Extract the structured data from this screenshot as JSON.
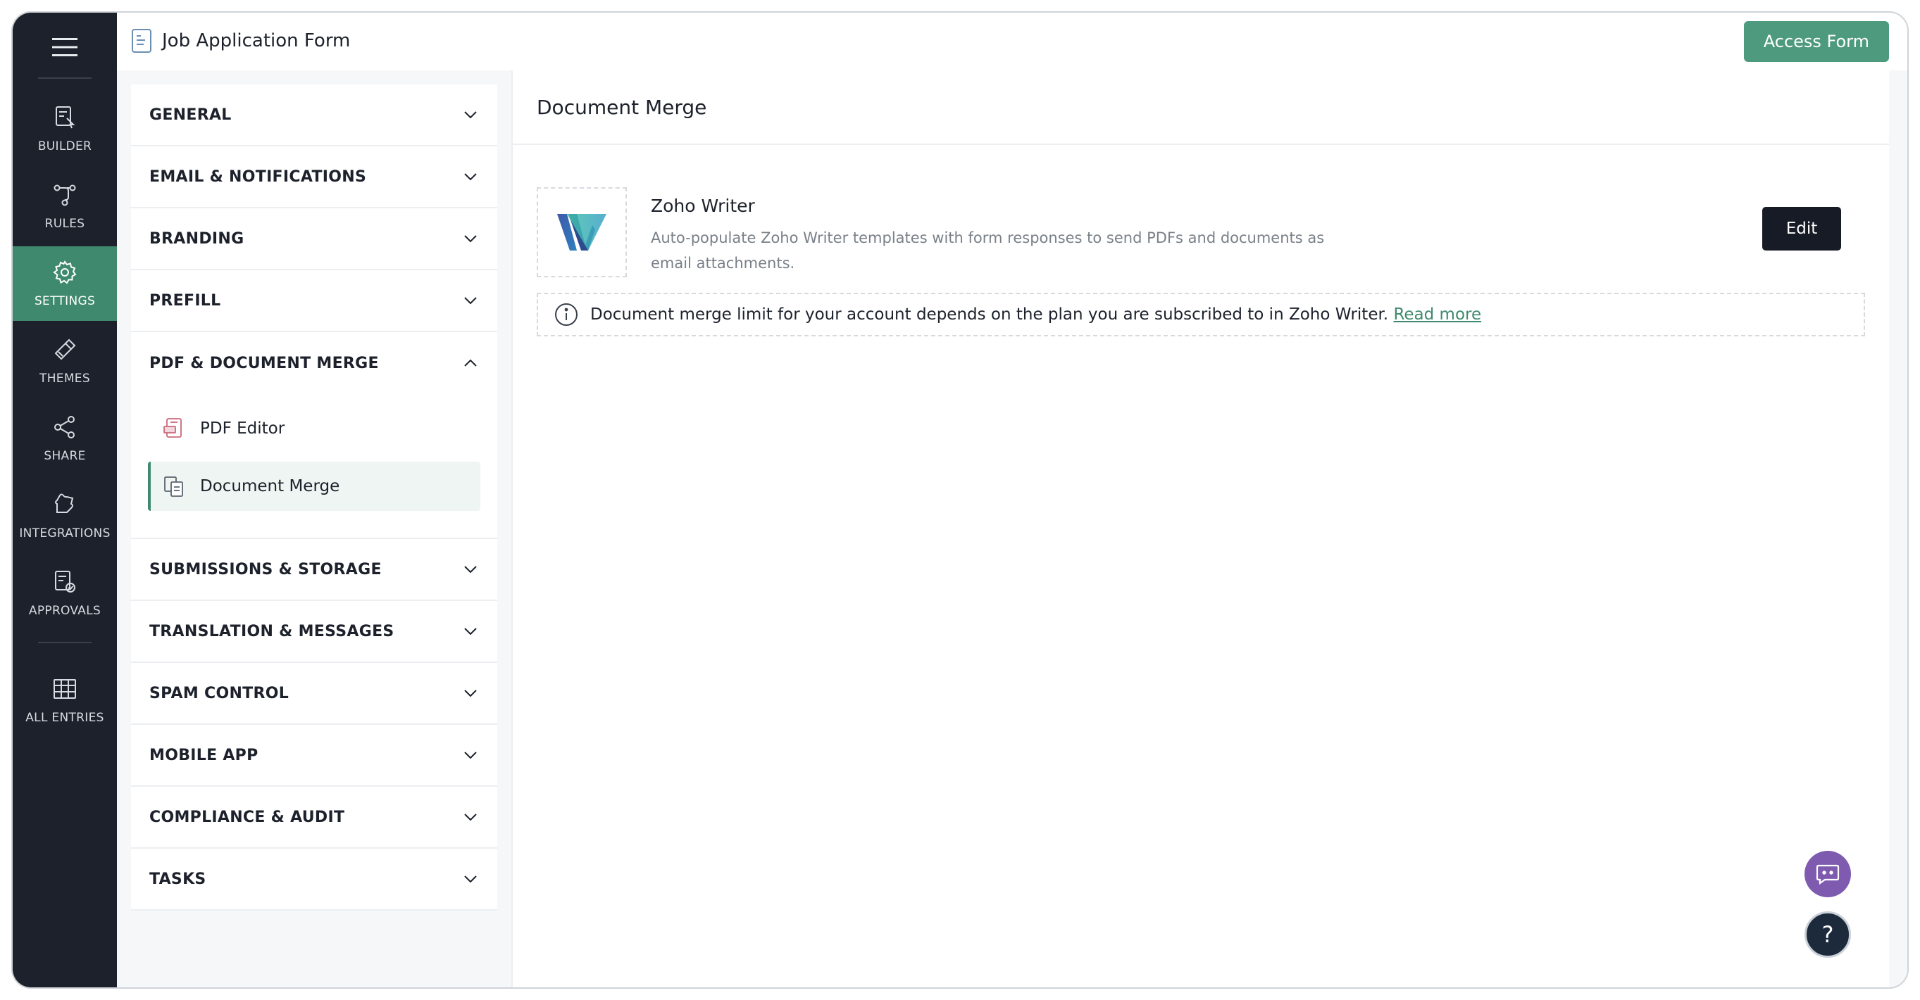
{
  "app": {
    "form_title": "Job Application Form",
    "access_button": "Access Form"
  },
  "rail": {
    "items": [
      {
        "label": "BUILDER",
        "icon": "builder-icon"
      },
      {
        "label": "RULES",
        "icon": "rules-icon"
      },
      {
        "label": "SETTINGS",
        "icon": "gear-icon"
      },
      {
        "label": "THEMES",
        "icon": "paint-icon"
      },
      {
        "label": "SHARE",
        "icon": "share-icon"
      },
      {
        "label": "INTEGRATIONS",
        "icon": "puzzle-icon"
      },
      {
        "label": "APPROVALS",
        "icon": "approvals-icon"
      },
      {
        "label": "ALL ENTRIES",
        "icon": "table-icon"
      }
    ],
    "active": "SETTINGS"
  },
  "menu": {
    "items": [
      {
        "label": "GENERAL"
      },
      {
        "label": "EMAIL & NOTIFICATIONS"
      },
      {
        "label": "BRANDING"
      },
      {
        "label": "PREFILL"
      },
      {
        "label": "PDF & DOCUMENT MERGE",
        "expanded": true
      },
      {
        "label": "SUBMISSIONS & STORAGE"
      },
      {
        "label": "TRANSLATION & MESSAGES"
      },
      {
        "label": "SPAM CONTROL"
      },
      {
        "label": "MOBILE APP"
      },
      {
        "label": "COMPLIANCE & AUDIT"
      },
      {
        "label": "TASKS"
      }
    ],
    "submenu": [
      {
        "label": "PDF Editor"
      },
      {
        "label": "Document Merge",
        "active": true
      }
    ]
  },
  "panel": {
    "title": "Document Merge",
    "integration": {
      "name": "Zoho Writer",
      "description": "Auto-populate Zoho Writer templates with form responses to send PDFs and documents as email attachments.",
      "edit_label": "Edit"
    },
    "notice": {
      "text": "Document merge limit for your account depends on the plan you are subscribed to in Zoho Writer.",
      "link": "Read more"
    }
  },
  "colors": {
    "rail_bg": "#1c212b",
    "accent": "#3f8a6e",
    "access_button": "#4d9a7e",
    "edit_button": "#161b26",
    "chat_fab": "#7f5bb0"
  },
  "fab": {
    "help_glyph": "?"
  }
}
